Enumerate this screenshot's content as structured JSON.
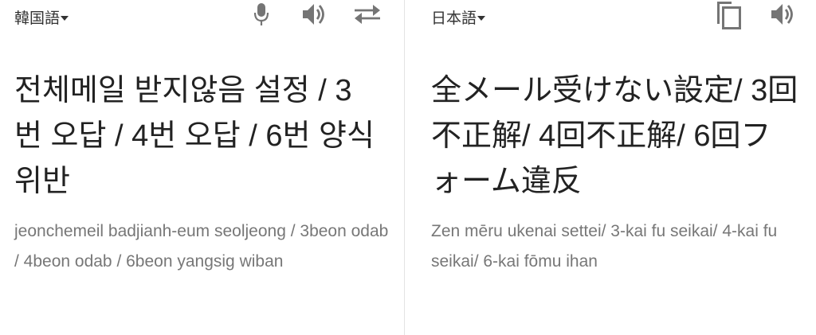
{
  "source": {
    "language_label": "韓国語",
    "text": "전체메일 받지않음 설정 / 3번 오답 / 4번 오답 / 6번 양식 위반",
    "romanization": "jeonchemeil badjianh-eum seoljeong / 3beon odab / 4beon odab / 6beon yangsig wiban",
    "icons": [
      "microphone-icon",
      "speaker-icon",
      "swap-icon"
    ]
  },
  "target": {
    "language_label": "日本語",
    "text": "全メール受けない設定/ 3回不正解/ 4回不正解/ 6回フォーム違反",
    "romanization": "Zen mēru ukenai settei/ 3-kai fu seikai/ 4-kai fu seikai/ 6-kai fōmu ihan",
    "icons": [
      "copy-icon",
      "speaker-icon"
    ]
  },
  "colors": {
    "icon": "#757575",
    "text": "#222222",
    "romanization": "#777777",
    "divider": "#e3e3e3"
  }
}
